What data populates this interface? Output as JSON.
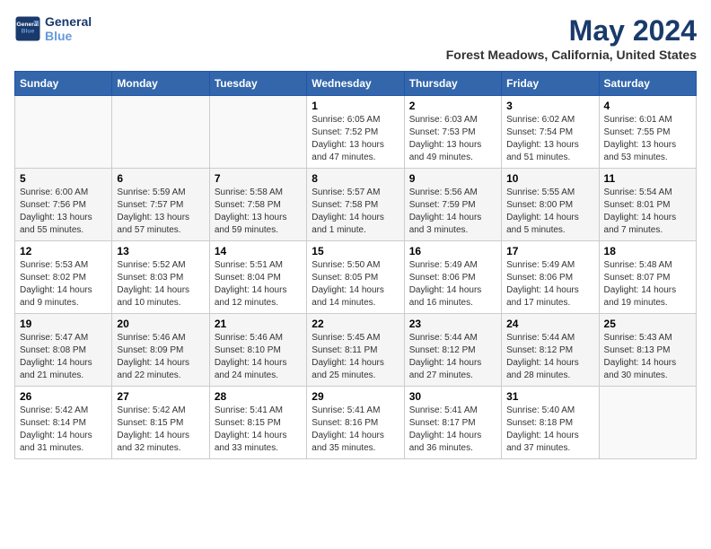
{
  "header": {
    "logo_line1": "General",
    "logo_line2": "Blue",
    "month_year": "May 2024",
    "location": "Forest Meadows, California, United States"
  },
  "days_header": [
    "Sunday",
    "Monday",
    "Tuesday",
    "Wednesday",
    "Thursday",
    "Friday",
    "Saturday"
  ],
  "weeks": [
    [
      {
        "num": "",
        "info": ""
      },
      {
        "num": "",
        "info": ""
      },
      {
        "num": "",
        "info": ""
      },
      {
        "num": "1",
        "info": "Sunrise: 6:05 AM\nSunset: 7:52 PM\nDaylight: 13 hours\nand 47 minutes."
      },
      {
        "num": "2",
        "info": "Sunrise: 6:03 AM\nSunset: 7:53 PM\nDaylight: 13 hours\nand 49 minutes."
      },
      {
        "num": "3",
        "info": "Sunrise: 6:02 AM\nSunset: 7:54 PM\nDaylight: 13 hours\nand 51 minutes."
      },
      {
        "num": "4",
        "info": "Sunrise: 6:01 AM\nSunset: 7:55 PM\nDaylight: 13 hours\nand 53 minutes."
      }
    ],
    [
      {
        "num": "5",
        "info": "Sunrise: 6:00 AM\nSunset: 7:56 PM\nDaylight: 13 hours\nand 55 minutes."
      },
      {
        "num": "6",
        "info": "Sunrise: 5:59 AM\nSunset: 7:57 PM\nDaylight: 13 hours\nand 57 minutes."
      },
      {
        "num": "7",
        "info": "Sunrise: 5:58 AM\nSunset: 7:58 PM\nDaylight: 13 hours\nand 59 minutes."
      },
      {
        "num": "8",
        "info": "Sunrise: 5:57 AM\nSunset: 7:58 PM\nDaylight: 14 hours\nand 1 minute."
      },
      {
        "num": "9",
        "info": "Sunrise: 5:56 AM\nSunset: 7:59 PM\nDaylight: 14 hours\nand 3 minutes."
      },
      {
        "num": "10",
        "info": "Sunrise: 5:55 AM\nSunset: 8:00 PM\nDaylight: 14 hours\nand 5 minutes."
      },
      {
        "num": "11",
        "info": "Sunrise: 5:54 AM\nSunset: 8:01 PM\nDaylight: 14 hours\nand 7 minutes."
      }
    ],
    [
      {
        "num": "12",
        "info": "Sunrise: 5:53 AM\nSunset: 8:02 PM\nDaylight: 14 hours\nand 9 minutes."
      },
      {
        "num": "13",
        "info": "Sunrise: 5:52 AM\nSunset: 8:03 PM\nDaylight: 14 hours\nand 10 minutes."
      },
      {
        "num": "14",
        "info": "Sunrise: 5:51 AM\nSunset: 8:04 PM\nDaylight: 14 hours\nand 12 minutes."
      },
      {
        "num": "15",
        "info": "Sunrise: 5:50 AM\nSunset: 8:05 PM\nDaylight: 14 hours\nand 14 minutes."
      },
      {
        "num": "16",
        "info": "Sunrise: 5:49 AM\nSunset: 8:06 PM\nDaylight: 14 hours\nand 16 minutes."
      },
      {
        "num": "17",
        "info": "Sunrise: 5:49 AM\nSunset: 8:06 PM\nDaylight: 14 hours\nand 17 minutes."
      },
      {
        "num": "18",
        "info": "Sunrise: 5:48 AM\nSunset: 8:07 PM\nDaylight: 14 hours\nand 19 minutes."
      }
    ],
    [
      {
        "num": "19",
        "info": "Sunrise: 5:47 AM\nSunset: 8:08 PM\nDaylight: 14 hours\nand 21 minutes."
      },
      {
        "num": "20",
        "info": "Sunrise: 5:46 AM\nSunset: 8:09 PM\nDaylight: 14 hours\nand 22 minutes."
      },
      {
        "num": "21",
        "info": "Sunrise: 5:46 AM\nSunset: 8:10 PM\nDaylight: 14 hours\nand 24 minutes."
      },
      {
        "num": "22",
        "info": "Sunrise: 5:45 AM\nSunset: 8:11 PM\nDaylight: 14 hours\nand 25 minutes."
      },
      {
        "num": "23",
        "info": "Sunrise: 5:44 AM\nSunset: 8:12 PM\nDaylight: 14 hours\nand 27 minutes."
      },
      {
        "num": "24",
        "info": "Sunrise: 5:44 AM\nSunset: 8:12 PM\nDaylight: 14 hours\nand 28 minutes."
      },
      {
        "num": "25",
        "info": "Sunrise: 5:43 AM\nSunset: 8:13 PM\nDaylight: 14 hours\nand 30 minutes."
      }
    ],
    [
      {
        "num": "26",
        "info": "Sunrise: 5:42 AM\nSunset: 8:14 PM\nDaylight: 14 hours\nand 31 minutes."
      },
      {
        "num": "27",
        "info": "Sunrise: 5:42 AM\nSunset: 8:15 PM\nDaylight: 14 hours\nand 32 minutes."
      },
      {
        "num": "28",
        "info": "Sunrise: 5:41 AM\nSunset: 8:15 PM\nDaylight: 14 hours\nand 33 minutes."
      },
      {
        "num": "29",
        "info": "Sunrise: 5:41 AM\nSunset: 8:16 PM\nDaylight: 14 hours\nand 35 minutes."
      },
      {
        "num": "30",
        "info": "Sunrise: 5:41 AM\nSunset: 8:17 PM\nDaylight: 14 hours\nand 36 minutes."
      },
      {
        "num": "31",
        "info": "Sunrise: 5:40 AM\nSunset: 8:18 PM\nDaylight: 14 hours\nand 37 minutes."
      },
      {
        "num": "",
        "info": ""
      }
    ]
  ]
}
